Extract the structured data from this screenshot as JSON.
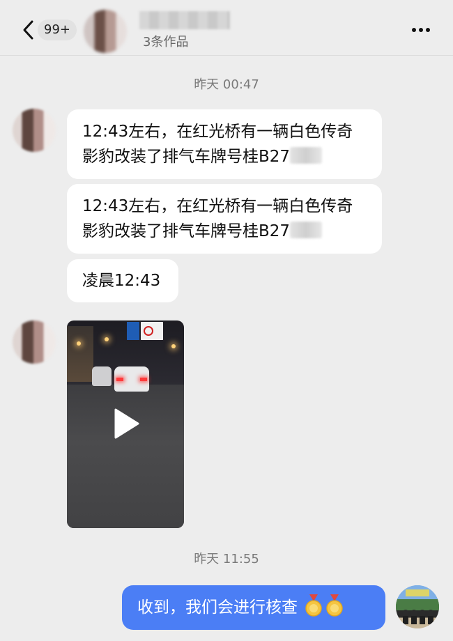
{
  "header": {
    "unread_badge": "99+",
    "subtitle": "3条作品",
    "icons": {
      "back": "chevron-left-icon",
      "more": "more-dots-icon"
    }
  },
  "messages": {
    "timestamp_1": "昨天 00:47",
    "incoming": [
      {
        "text": "12:43左右，在红光桥有一辆白色传奇影豹改装了排气车牌号桂B27"
      },
      {
        "text": "12:43左右，在红光桥有一辆白色传奇影豹改装了排气车牌号桂B27"
      },
      {
        "text": "凌晨12:43"
      }
    ],
    "video": {
      "icon": "play-icon"
    },
    "timestamp_2": "昨天 11:55",
    "outgoing": {
      "text": "收到，我们会进行核查"
    }
  },
  "colors": {
    "background": "#ededed",
    "bubble_incoming": "#ffffff",
    "bubble_outgoing": "#4b7ef5"
  }
}
